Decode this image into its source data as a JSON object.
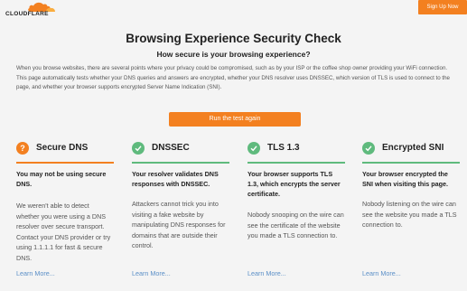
{
  "header": {
    "logo_text": "CLOUDFLARE",
    "signup_label": "Sign Up Now"
  },
  "page": {
    "title": "Browsing Experience Security Check",
    "subtitle": "How secure is your browsing experience?",
    "intro": "When you browse websites, there are several points where your privacy could be compromised, such as by your ISP or the coffee shop owner providing your WiFi connection. This page automatically tests whether your DNS queries and answers are encrypted, whether your DNS resolver uses DNSSEC, which version of TLS is used to connect to the page, and whether your browser supports encrypted Server Name Indication (SNI).",
    "run_button": "Run the test again"
  },
  "colors": {
    "accent": "#f38020",
    "pass": "#5fba7d",
    "warn": "#f38020",
    "link": "#5b8fc7"
  },
  "cards": [
    {
      "title": "Secure DNS",
      "status": "warn",
      "icon": "question-icon",
      "lead": "You may not be using secure DNS.",
      "body": "We weren't able to detect whether you were using a DNS resolver over secure transport. Contact your DNS provider or try using 1.1.1.1 for fast & secure DNS.",
      "link": "Learn More..."
    },
    {
      "title": "DNSSEC",
      "status": "pass",
      "icon": "check-icon",
      "lead": "Your resolver validates DNS responses with DNSSEC.",
      "body": "Attackers cannot trick you into visiting a fake website by manipulating DNS responses for domains that are outside their control.",
      "link": "Learn More..."
    },
    {
      "title": "TLS 1.3",
      "status": "pass",
      "icon": "check-icon",
      "lead": "Your browser supports TLS 1.3, which encrypts the server certificate.",
      "body": "Nobody snooping on the wire can see the certificate of the website you made a TLS connection to.",
      "link": "Learn More..."
    },
    {
      "title": "Encrypted SNI",
      "status": "pass",
      "icon": "check-icon",
      "lead": "Your browser encrypted the SNI when visiting this page.",
      "body": "Nobody listening on the wire can see the website you made a TLS connection to.",
      "link": "Learn More..."
    }
  ]
}
